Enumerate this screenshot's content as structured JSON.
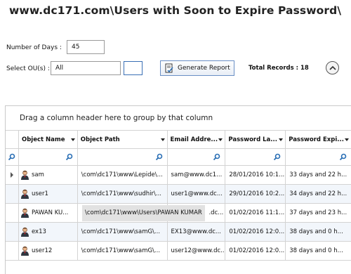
{
  "page": {
    "title": "www.dc171.com\\Users with Soon to Expire Password\\"
  },
  "form": {
    "days_label": "Number of Days :",
    "days_value": "45",
    "ou_label": "Select OU(s) :",
    "ou_value": "All",
    "generate_label": "Generate Report",
    "total_label": "Total Records : 18"
  },
  "grid": {
    "group_hint": "Drag a column header here to group by that column",
    "columns": [
      "Object Name",
      "Object Path",
      "Email Addre...",
      "Password La...",
      "Password Expi..."
    ],
    "rows": [
      {
        "name": "sam",
        "path": "\\com\\dc171\\www\\Lepide\\...",
        "email": "sam@www.dc1...",
        "last": "28/01/2016 10:1...",
        "expiry": "33 days and 22 h..."
      },
      {
        "name": "user1",
        "path": "\\com\\dc171\\www\\sudhir\\...",
        "email": "user1@www.dc...",
        "last": "29/01/2016 10:2...",
        "expiry": "34 days and 22 h..."
      },
      {
        "name": "PAWAN KU...",
        "path": "",
        "email": ".dc...",
        "last": "01/02/2016 11:1...",
        "expiry": "37 days and 23 h..."
      },
      {
        "name": "ex13",
        "path": "\\com\\dc171\\www\\samG\\...",
        "email": "EX13@www.dc...",
        "last": "01/02/2016 12:0...",
        "expiry": "38 days and 0 h..."
      },
      {
        "name": "user12",
        "path": "\\com\\dc171\\www\\samG\\...",
        "email": "user12@www.dc...",
        "last": "01/02/2016 12:0...",
        "expiry": "38 days and 0 h..."
      }
    ],
    "tooltip": "\\com\\dc171\\www\\Users\\PAWAN KUMAR"
  }
}
